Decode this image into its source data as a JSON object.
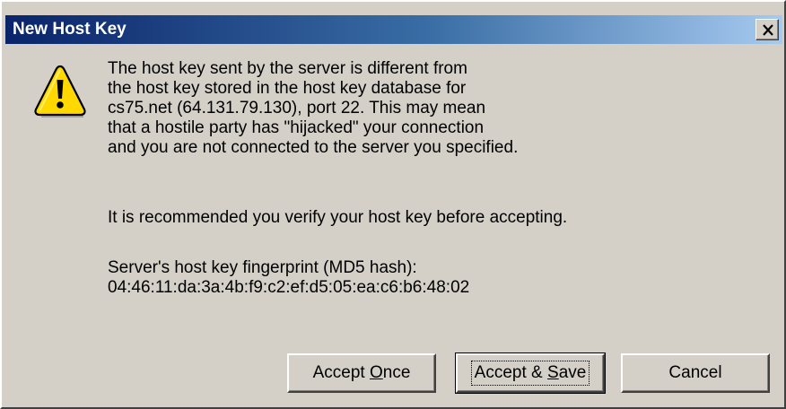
{
  "window": {
    "title": "New Host Key",
    "close_glyph": "✕"
  },
  "icon": {
    "name": "warning-icon",
    "glyph": "!"
  },
  "message": {
    "paragraph1": [
      "The host key sent by the server is different from",
      "the host key stored in the host key database for",
      "cs75.net (64.131.79.130), port 22.  This may mean",
      "that a hostile party has \"hijacked\" your connection",
      "and you are not connected to the server you specified."
    ],
    "paragraph2": "It is recommended you verify your host key before accepting.",
    "fingerprint_label": "Server's host key fingerprint (MD5 hash):",
    "fingerprint_value": "04:46:11:da:3a:4b:f9:c2:ef:d5:05:ea:c6:b6:48:02"
  },
  "buttons": {
    "accept_once": {
      "prefix": "Accept ",
      "accel": "O",
      "suffix": "nce"
    },
    "accept_save": {
      "prefix": "Accept & ",
      "accel": "S",
      "suffix": "ave"
    },
    "cancel": {
      "label": "Cancel"
    }
  },
  "colors": {
    "titlebar_start": "#0a246a",
    "titlebar_end": "#a6caf0",
    "face": "#d4d0c8",
    "warning_fill": "#ffd800"
  }
}
